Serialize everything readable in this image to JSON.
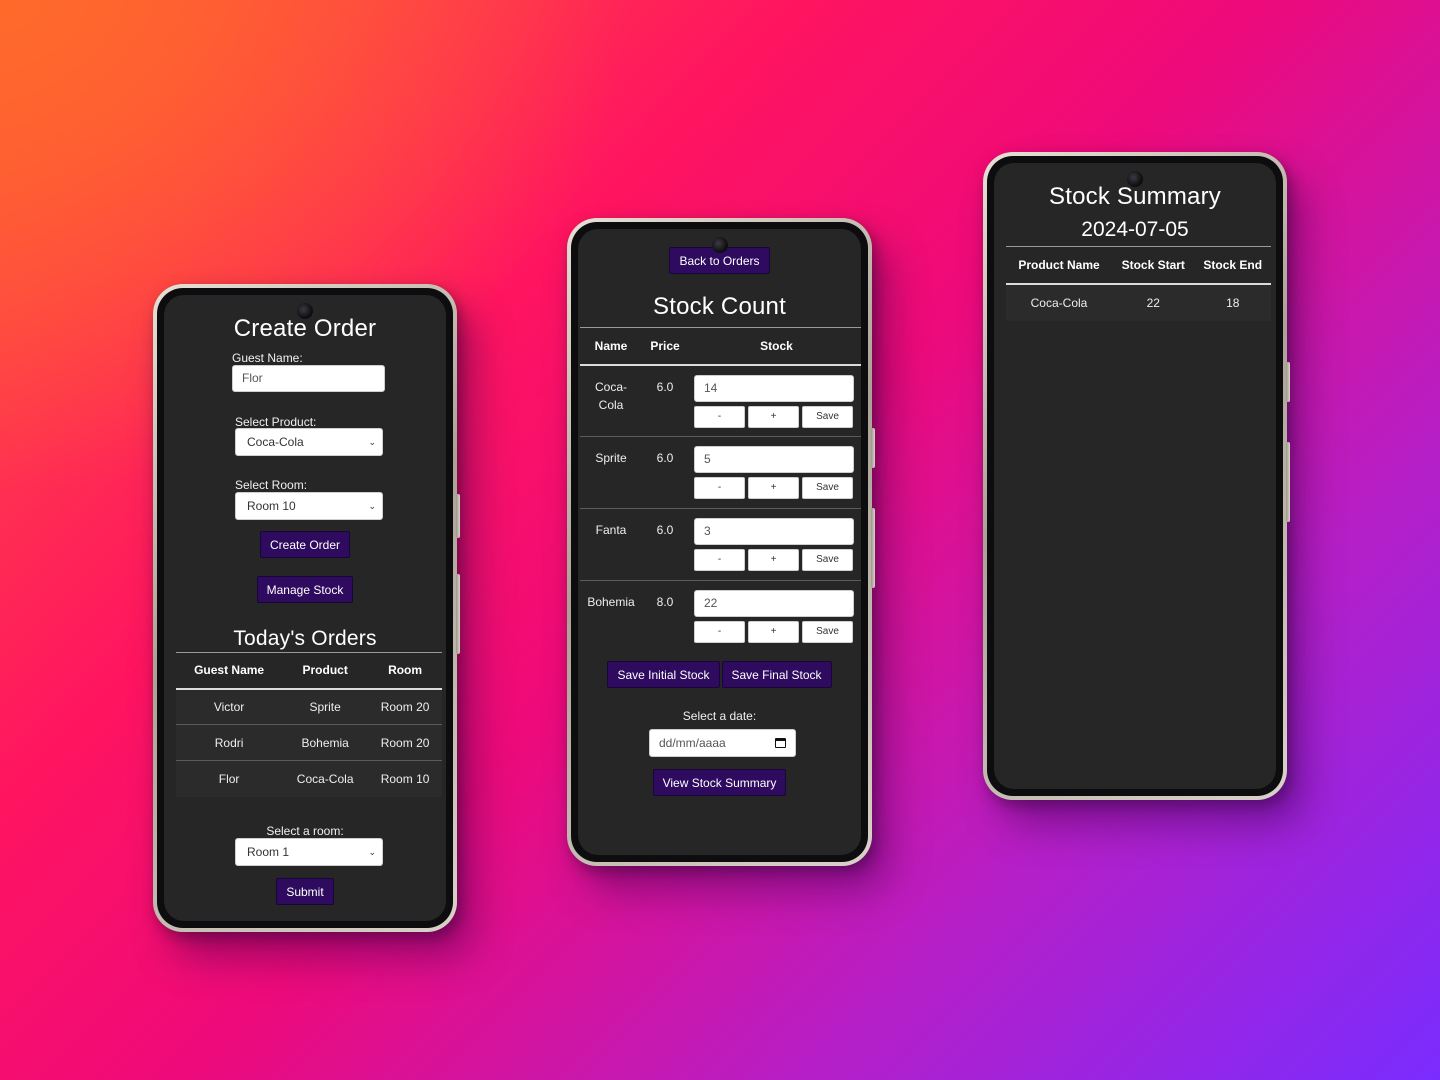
{
  "left": {
    "title": "Create Order",
    "guest_label": "Guest Name:",
    "guest_value": "Flor",
    "product_label": "Select Product:",
    "product_value": "Coca-Cola",
    "room_label": "Select Room:",
    "room_value": "Room 10",
    "create_button": "Create Order",
    "manage_button": "Manage Stock",
    "orders_title": "Today's Orders",
    "orders_columns": [
      "Guest Name",
      "Product",
      "Room"
    ],
    "orders_rows": [
      [
        "Victor",
        "Sprite",
        "Room 20"
      ],
      [
        "Rodri",
        "Bohemia",
        "Room 20"
      ],
      [
        "Flor",
        "Coca-Cola",
        "Room 10"
      ]
    ],
    "select_room_label": "Select a room:",
    "select_room_value": "Room 1",
    "submit_button": "Submit"
  },
  "middle": {
    "back_button": "Back to Orders",
    "title": "Stock Count",
    "columns": [
      "Name",
      "Price",
      "Stock"
    ],
    "rows": [
      {
        "name": "Coca-\nCola",
        "price": "6.0",
        "stock": "14"
      },
      {
        "name": "Sprite",
        "price": "6.0",
        "stock": "5"
      },
      {
        "name": "Fanta",
        "price": "6.0",
        "stock": "3"
      },
      {
        "name": "Bohemia",
        "price": "8.0",
        "stock": "22"
      }
    ],
    "minus_label": "-",
    "plus_label": "+",
    "save_label": "Save",
    "save_initial_button": "Save Initial Stock",
    "save_final_button": "Save Final Stock",
    "date_label": "Select a date:",
    "date_placeholder": "dd/mm/aaaa",
    "view_summary_button": "View Stock Summary"
  },
  "right": {
    "title": "Stock Summary",
    "date": "2024-07-05",
    "columns": [
      "Product Name",
      "Stock Start",
      "Stock End"
    ],
    "rows": [
      [
        "Coca-Cola",
        "22",
        "18"
      ]
    ]
  },
  "colors": {
    "button_purple": "#2e0b5e",
    "screen_bg": "#262626"
  }
}
